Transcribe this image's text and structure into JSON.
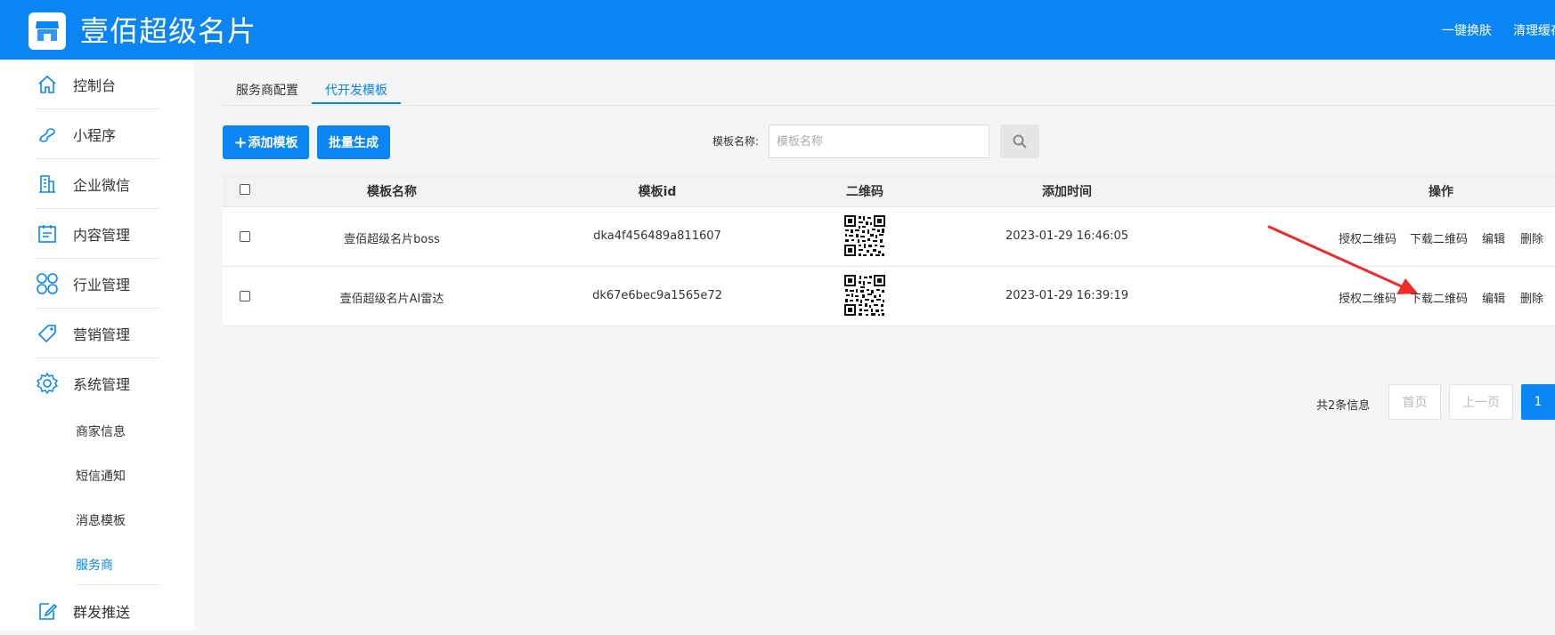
{
  "header": {
    "title": "壹佰超级名片",
    "links": [
      "一键换肤",
      "清理缓存"
    ]
  },
  "sidebar": {
    "items": [
      {
        "label": "控制台",
        "icon": "home-icon"
      },
      {
        "label": "小程序",
        "icon": "miniprogram-icon"
      },
      {
        "label": "企业微信",
        "icon": "building-icon"
      },
      {
        "label": "内容管理",
        "icon": "clipboard-icon"
      },
      {
        "label": "行业管理",
        "icon": "grid-icon"
      },
      {
        "label": "营销管理",
        "icon": "tag-icon"
      },
      {
        "label": "系统管理",
        "icon": "gear-icon"
      }
    ],
    "sub_items": [
      "商家信息",
      "短信通知",
      "消息模板",
      "服务商"
    ],
    "active_sub": "服务商",
    "last_item": {
      "label": "群发推送",
      "icon": "edit-icon"
    }
  },
  "tabs": [
    "服务商配置",
    "代开发模板"
  ],
  "active_tab": "代开发模板",
  "toolbar": {
    "add_label": "添加模板",
    "batch_label": "批量生成",
    "search_label": "模板名称:",
    "search_placeholder": "模板名称"
  },
  "table": {
    "headers": [
      "模板名称",
      "模板id",
      "二维码",
      "添加时间",
      "操作"
    ],
    "rows": [
      {
        "name": "壹佰超级名片boss",
        "id": "dka4f456489a811607",
        "time": "2023-01-29 16:46:05"
      },
      {
        "name": "壹佰超级名片AI雷达",
        "id": "dk67e6bec9a1565e72",
        "time": "2023-01-29 16:39:19"
      }
    ],
    "actions": [
      "授权二维码",
      "下载二维码",
      "编辑",
      "删除"
    ]
  },
  "pagination": {
    "total": "共2条信息",
    "first": "首页",
    "prev": "上一页",
    "current": "1"
  },
  "colors": {
    "primary": "#0a85f3",
    "annotation_arrow": "#ee2b2b"
  }
}
